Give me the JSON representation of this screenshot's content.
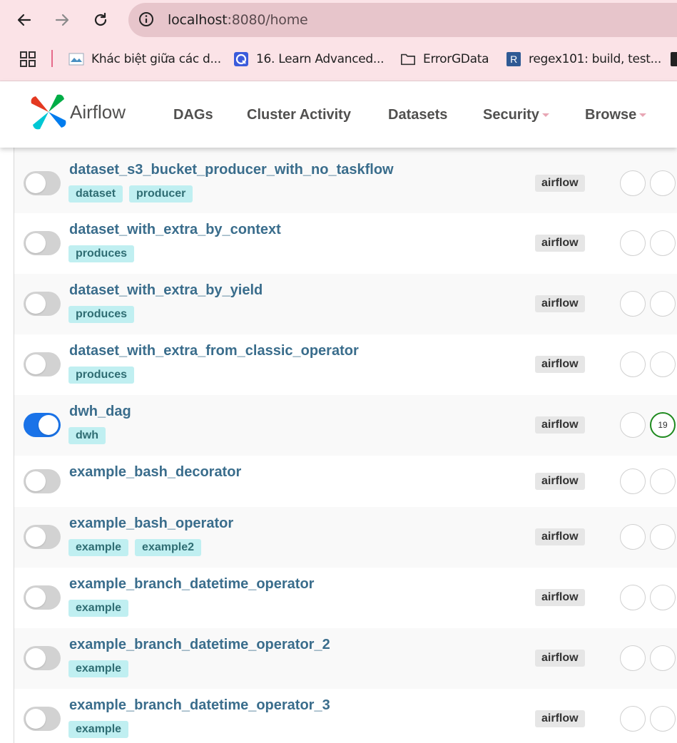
{
  "browser": {
    "url_host": "localhost",
    "url_rest": ":8080/home",
    "bookmarks": [
      {
        "label": "Khác biệt giữa các d...",
        "icon": "site-favicon-icon"
      },
      {
        "label": "16. Learn Advanced...",
        "icon": "course-favicon-icon"
      },
      {
        "label": "ErrorGData",
        "icon": "folder-icon"
      },
      {
        "label": "regex101: build, test...",
        "icon": "regex101-favicon-icon"
      }
    ]
  },
  "navbar": {
    "brand": "Airflow",
    "menu": [
      {
        "label": "DAGs",
        "dropdown": false
      },
      {
        "label": "Cluster Activity",
        "dropdown": false
      },
      {
        "label": "Datasets",
        "dropdown": false
      },
      {
        "label": "Security",
        "dropdown": true
      },
      {
        "label": "Browse",
        "dropdown": true
      }
    ]
  },
  "dags": [
    {
      "name": "dataset_s3_bucket_producer_with_no_taskflow",
      "tags": [
        "dataset",
        "producer"
      ],
      "owner": "airflow",
      "paused": true,
      "run_count": ""
    },
    {
      "name": "dataset_with_extra_by_context",
      "tags": [
        "produces"
      ],
      "owner": "airflow",
      "paused": true,
      "run_count": ""
    },
    {
      "name": "dataset_with_extra_by_yield",
      "tags": [
        "produces"
      ],
      "owner": "airflow",
      "paused": true,
      "run_count": ""
    },
    {
      "name": "dataset_with_extra_from_classic_operator",
      "tags": [
        "produces"
      ],
      "owner": "airflow",
      "paused": true,
      "run_count": ""
    },
    {
      "name": "dwh_dag",
      "tags": [
        "dwh"
      ],
      "owner": "airflow",
      "paused": false,
      "run_count": "19"
    },
    {
      "name": "example_bash_decorator",
      "tags": [],
      "owner": "airflow",
      "paused": true,
      "run_count": ""
    },
    {
      "name": "example_bash_operator",
      "tags": [
        "example",
        "example2"
      ],
      "owner": "airflow",
      "paused": true,
      "run_count": ""
    },
    {
      "name": "example_branch_datetime_operator",
      "tags": [
        "example"
      ],
      "owner": "airflow",
      "paused": true,
      "run_count": ""
    },
    {
      "name": "example_branch_datetime_operator_2",
      "tags": [
        "example"
      ],
      "owner": "airflow",
      "paused": true,
      "run_count": ""
    },
    {
      "name": "example_branch_datetime_operator_3",
      "tags": [
        "example"
      ],
      "owner": "airflow",
      "paused": true,
      "run_count": ""
    }
  ],
  "colors": {
    "toggle_on": "#1a73e8",
    "success_ring": "#1e8a1e",
    "dag_link": "#3a6d8c",
    "tag_bg": "#c0eff1"
  }
}
